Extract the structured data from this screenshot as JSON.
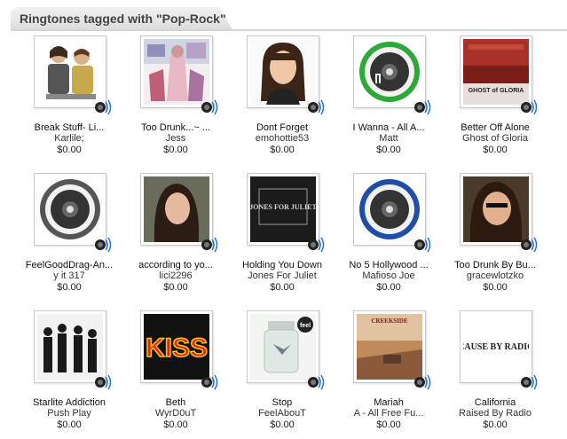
{
  "section": {
    "title": "Ringtones tagged with \"Pop-Rock\""
  },
  "ringtones": [
    {
      "name": "Break Stuff- Li...",
      "artist": "Karlile;",
      "price": "$0.00",
      "art": "cartoon-duo-art"
    },
    {
      "name": "Too Drunk...~ ...",
      "artist": "Jess",
      "price": "$0.00",
      "art": "concert-photo-art"
    },
    {
      "name": "Dont Forget",
      "artist": "emohottie53",
      "price": "$0.00",
      "art": "portrait-art"
    },
    {
      "name": "I Wanna - All A...",
      "artist": "Matt",
      "price": "$0.00",
      "art": "green-speaker-icon"
    },
    {
      "name": "Better Off Alone",
      "artist": "Ghost of Gloria",
      "price": "$0.00",
      "art": "album-cover-red"
    },
    {
      "name": "FeelGoodDrag-An...",
      "artist": "y it 317",
      "price": "$0.00",
      "art": "gray-speaker-icon"
    },
    {
      "name": "according to yo...",
      "artist": "lici2296",
      "price": "$0.00",
      "art": "portrait-art"
    },
    {
      "name": "Holding You Down",
      "artist": "Jones For Juliet",
      "price": "$0.00",
      "art": "band-logo-art"
    },
    {
      "name": "No 5 Hollywood ...",
      "artist": "Mafioso Joe",
      "price": "$0.00",
      "art": "blue-speaker-icon"
    },
    {
      "name": "Too Drunk By Bu...",
      "artist": "gracewlotzko",
      "price": "$0.00",
      "art": "portrait-art"
    },
    {
      "name": "Starlite Addiction",
      "artist": "Push Play",
      "price": "$0.00",
      "art": "band-photo-art"
    },
    {
      "name": "Beth",
      "artist": "WyrD0uT",
      "price": "$0.00",
      "art": "kiss-logo-art"
    },
    {
      "name": "Stop",
      "artist": "FeelAbouT",
      "price": "$0.00",
      "art": "jar-art"
    },
    {
      "name": "Mariah",
      "artist": "A - All Free Fu...",
      "price": "$0.00",
      "art": "album-cover-road"
    },
    {
      "name": "California",
      "artist": "Raised By Radio",
      "price": "$0.00",
      "art": "text-logo-art"
    }
  ],
  "labels": {
    "c11": "GHOST of GLORIA",
    "c8": "JONES FOR JULIET",
    "c12": "KISS",
    "c13": "feel",
    "c14": "CREEKSIDE",
    "c15": "CAUSE BY RADIO"
  }
}
